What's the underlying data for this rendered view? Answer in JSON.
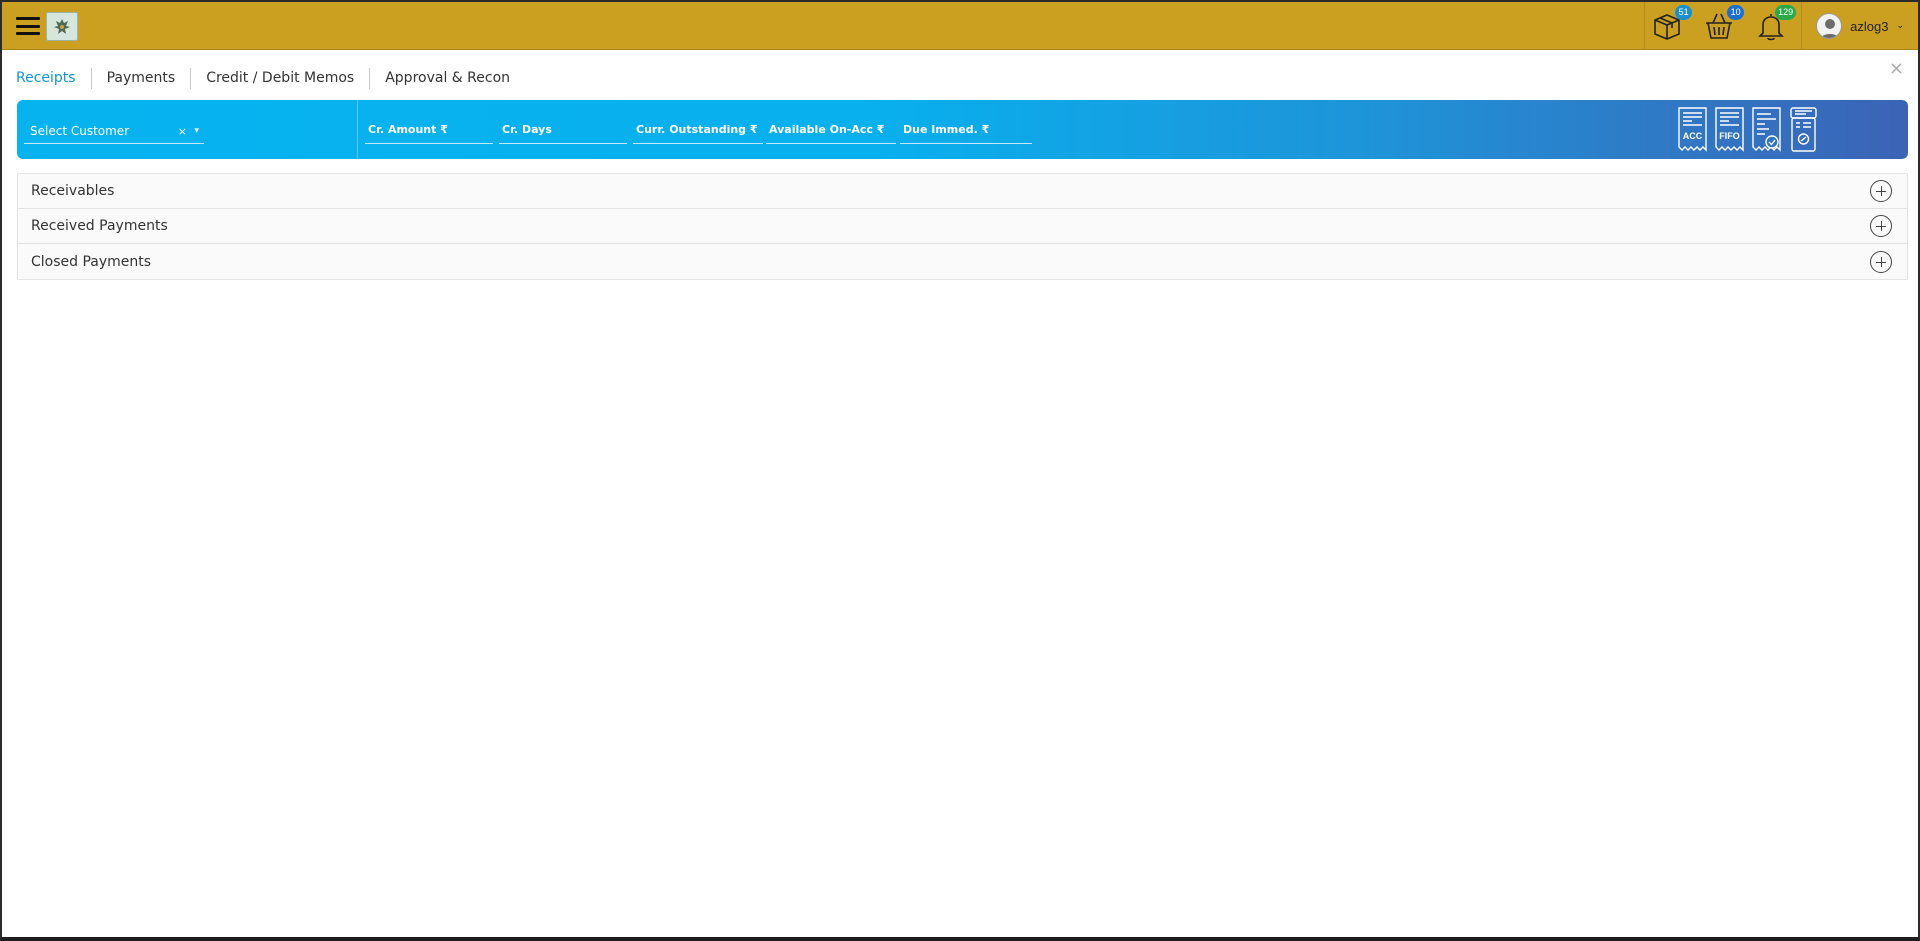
{
  "header": {
    "user_name": "azlog3",
    "icons": [
      {
        "name": "package-icon",
        "badge": "51",
        "badge_color": "#1a8fd0"
      },
      {
        "name": "basket-icon",
        "badge": "10",
        "badge_color": "#1a6fd0"
      },
      {
        "name": "bell-icon",
        "badge": "129",
        "badge_color": "#2aa84a"
      }
    ],
    "bar_color": "#cba021"
  },
  "tabs": [
    {
      "label": "Receipts",
      "active": true
    },
    {
      "label": "Payments",
      "active": false
    },
    {
      "label": "Credit / Debit Memos",
      "active": false
    },
    {
      "label": "Approval & Recon",
      "active": false
    }
  ],
  "filter": {
    "customer_placeholder": "Select Customer",
    "clear": "×",
    "caret": "▾",
    "fields": [
      {
        "label": "Cr. Amount ₹"
      },
      {
        "label": "Cr. Days"
      },
      {
        "label": "Curr. Outstanding ₹"
      },
      {
        "label": "Available On-Acc ₹"
      },
      {
        "label": "Due Immed. ₹"
      }
    ],
    "actions": [
      {
        "name": "acc-receipt-icon",
        "text": "ACC"
      },
      {
        "name": "fifo-receipt-icon",
        "text": "FIFO"
      },
      {
        "name": "approve-receipt-icon",
        "text": ""
      },
      {
        "name": "device-receipt-icon",
        "text": ""
      }
    ]
  },
  "sections": [
    {
      "title": "Receivables"
    },
    {
      "title": "Received Payments"
    },
    {
      "title": "Closed Payments"
    }
  ],
  "close_symbol": "×"
}
